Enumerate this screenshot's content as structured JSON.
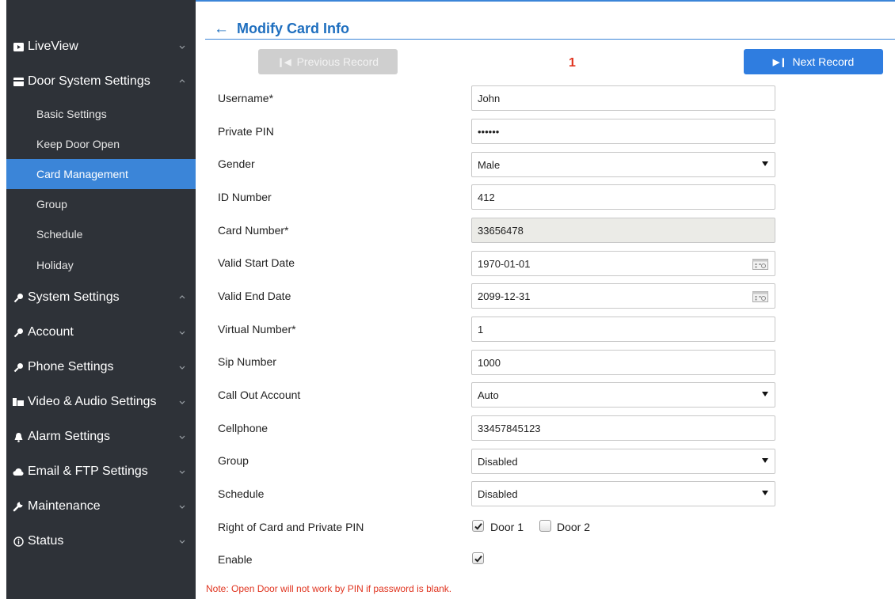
{
  "sidebar": {
    "main_items": [
      {
        "label": "LiveView"
      },
      {
        "label": "Door System Settings"
      },
      {
        "label": "System Settings"
      },
      {
        "label": "Account"
      },
      {
        "label": "Phone Settings"
      },
      {
        "label": "Video & Audio Settings"
      },
      {
        "label": "Alarm Settings"
      },
      {
        "label": "Email & FTP Settings"
      },
      {
        "label": "Maintenance"
      },
      {
        "label": "Status"
      }
    ],
    "sub_items": [
      {
        "label": "Basic Settings"
      },
      {
        "label": "Keep Door Open"
      },
      {
        "label": "Card Management",
        "active": true
      },
      {
        "label": "Group"
      },
      {
        "label": "Schedule"
      },
      {
        "label": "Holiday"
      }
    ]
  },
  "header": {
    "back_symbol": "←",
    "title": "Modify Card Info"
  },
  "record_nav": {
    "prev_label": "Previous Record",
    "next_label": "Next Record",
    "current": "1"
  },
  "form": {
    "username": {
      "label": "Username*",
      "value": "John"
    },
    "private_pin": {
      "label": "Private PIN",
      "value": "••••••"
    },
    "gender": {
      "label": "Gender",
      "value": "Male"
    },
    "id_number": {
      "label": "ID Number",
      "value": "412"
    },
    "card_number": {
      "label": "Card Number*",
      "value": "33656478"
    },
    "valid_start": {
      "label": "Valid Start Date",
      "value": "1970-01-01"
    },
    "valid_end": {
      "label": "Valid End Date",
      "value": "2099-12-31"
    },
    "virtual_number": {
      "label": "Virtual Number*",
      "value": "1"
    },
    "sip_number": {
      "label": "Sip Number",
      "value": "1000"
    },
    "call_out_account": {
      "label": "Call Out Account",
      "value": "Auto"
    },
    "cellphone": {
      "label": "Cellphone",
      "value": "33457845123"
    },
    "group": {
      "label": "Group",
      "value": "Disabled"
    },
    "schedule": {
      "label": "Schedule",
      "value": "Disabled"
    },
    "right": {
      "label": "Right of Card and Private PIN",
      "door1": "Door 1",
      "door1_checked": true,
      "door2": "Door 2",
      "door2_checked": false
    },
    "enable": {
      "label": "Enable",
      "checked": true
    }
  },
  "note": "Note: Open Door will not work by PIN if password is blank.",
  "colors": {
    "accent": "#2f7de0",
    "sidebar_bg": "#2e3238",
    "active_bg": "#3b85d8",
    "note_red": "#e0341f"
  }
}
